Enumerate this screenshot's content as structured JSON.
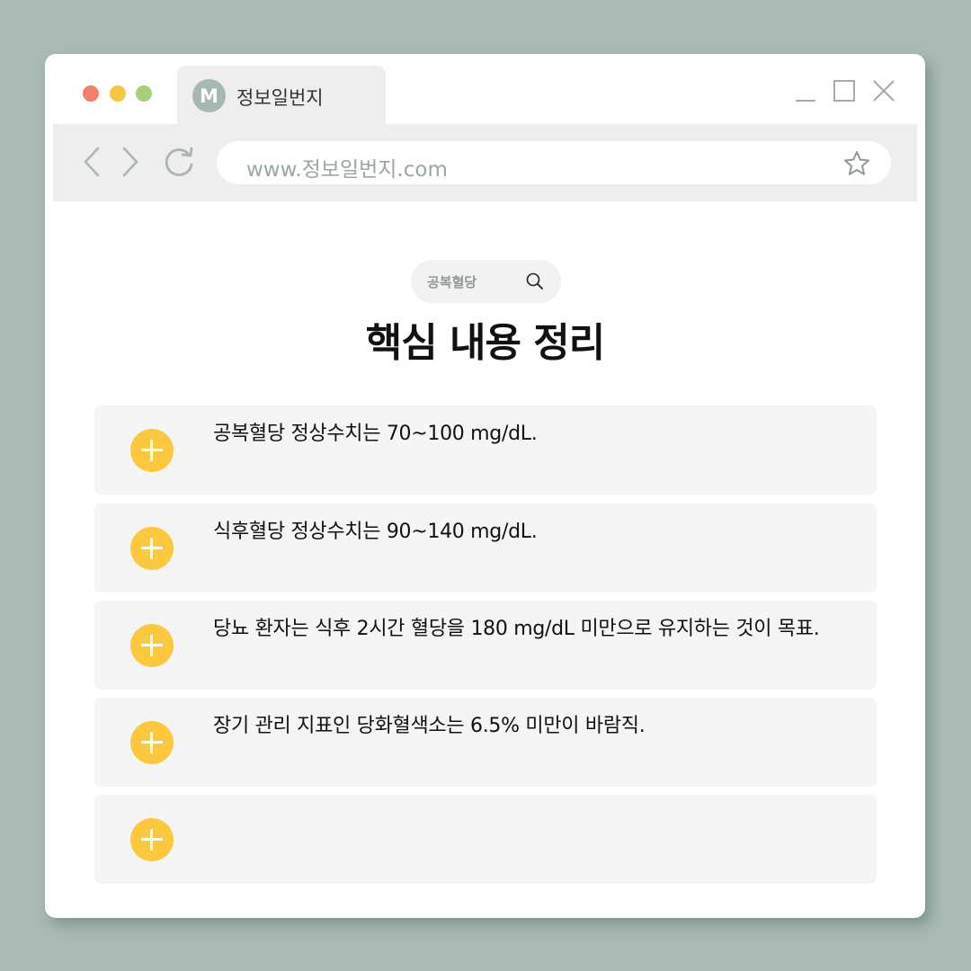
{
  "window": {
    "tab_title": "정보일번지",
    "tab_logo_letter": "M"
  },
  "toolbar": {
    "url": "www.정보일번지.com"
  },
  "search": {
    "label": "공복혈당"
  },
  "main": {
    "title": "핵심 내용 정리",
    "items": [
      {
        "text": "공복혈당 정상수치는 70~100 mg/dL."
      },
      {
        "text": "식후혈당 정상수치는 90~140 mg/dL."
      },
      {
        "text": "당뇨 환자는 식후 2시간 혈당을 180 mg/dL 미만으로 유지하는 것이 목표."
      },
      {
        "text": "장기 관리 지표인 당화혈색소는 6.5% 미만이 바람직."
      },
      {
        "text": ""
      }
    ]
  },
  "colors": {
    "background": "#a9bab5",
    "accent": "#fcc93e",
    "dot_red": "#f47f6b",
    "dot_yellow": "#f6c644",
    "dot_green": "#a5d07c"
  },
  "icons": [
    "close-dot-icon",
    "minimize-dot-icon",
    "maximize-dot-icon",
    "back-icon",
    "forward-icon",
    "reload-icon",
    "star-icon",
    "search-icon",
    "plus-icon"
  ]
}
